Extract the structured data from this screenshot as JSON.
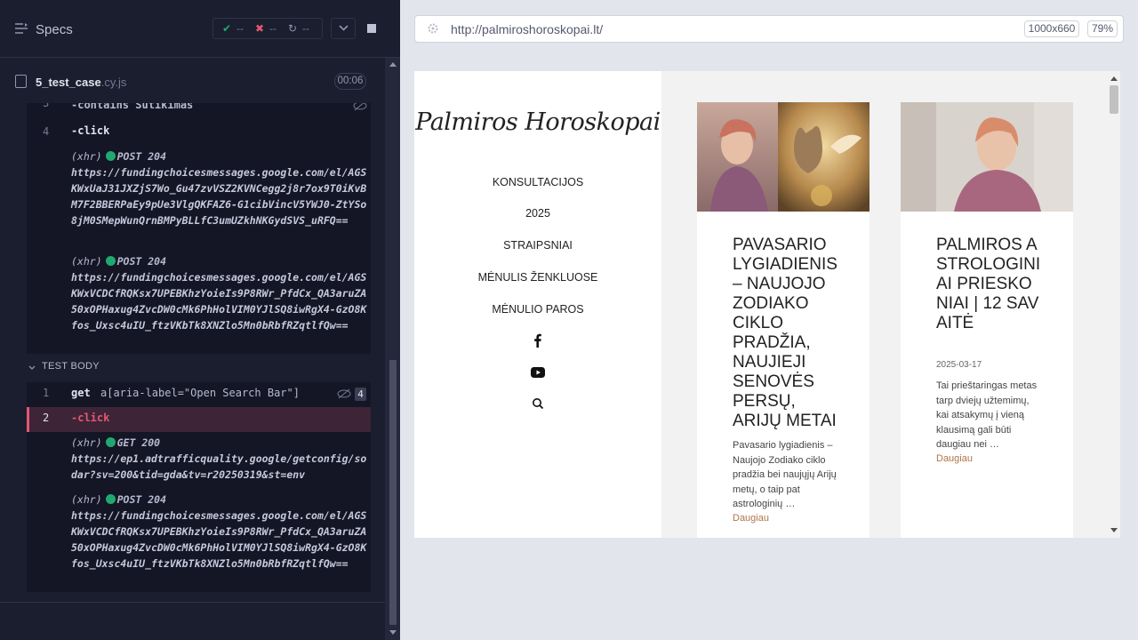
{
  "specs": {
    "title": "Specs",
    "passed": "--",
    "failed": "--",
    "pending": "--"
  },
  "file": {
    "name": "5_test_case",
    "ext": ".cy.js",
    "timer": "00:06"
  },
  "before_hook": {
    "line3_num": "3",
    "line3_text": "-contains  Sutikimas",
    "line4_num": "4",
    "line4_cmd": "-click",
    "xhr1_label": "(xhr)",
    "xhr1_status": "POST 204",
    "xhr1_url": "https://fundingchoicesmessages.google.com/el/AGSKWxUaJ31JXZjS7Wo_Gu47zvVSZ2KVNCegg2j8r7ox9T0iKvBM7F2BBERPaEy9pUe3VlgQKFAZ6-G1cibVincV5YWJ0-ZtYSo8jM0SMepWunQrnBMPyBLLfC3umUZkhNKGydSVS_uRFQ==",
    "xhr2_label": "(xhr)",
    "xhr2_status": "POST 204",
    "xhr2_url": "https://fundingchoicesmessages.google.com/el/AGSKWxVCDCfRQKsx7UPEBKhzYoieIs9P8RWr_PfdCx_QA3aruZA50xOPHaxug4ZvcDW0cMk6PhHolVIM0YJlSQ8iwRgX4-GzO8Kfos_Uxsc4uIU_ftzVKbTk8XNZlo5Mn0bRbfRZqtlfQw=="
  },
  "test_body": {
    "label": "TEST BODY",
    "l1_num": "1",
    "l1_cmd": "get",
    "l1_arg": "a[aria-label=\"Open Search Bar\"]",
    "l1_count": "4",
    "l2_num": "2",
    "l2_cmd": "-click",
    "xhr1_label": "(xhr)",
    "xhr1_status": "GET 200",
    "xhr1_url": "https://ep1.adtrafficquality.google/getconfig/sodar?sv=200&tid=gda&tv=r20250319&st=env",
    "xhr2_label": "(xhr)",
    "xhr2_status": "POST 204",
    "xhr2_url": "https://fundingchoicesmessages.google.com/el/AGSKWxVCDCfRQKsx7UPEBKhzYoieIs9P8RWr_PfdCx_QA3aruZA50xOPHaxug4ZvcDW0cMk6PhHolVIM0YJlSQ8iwRgX4-GzO8Kfos_Uxsc4uIU_ftzVKbTk8XNZlo5Mn0bRbfRZqtlfQw=="
  },
  "browser": {
    "url": "http://palmiroshoroskopai.lt/",
    "viewport": "1000x660",
    "zoom": "79%"
  },
  "site": {
    "logo": "Palmiros Horoskopai",
    "nav": [
      "KONSULTACIJOS",
      "2025",
      "STRAIPSNIAI",
      "MĖNULIS ŽENKLUOSE",
      "MĖNULIO PAROS"
    ],
    "cards": [
      {
        "title": "PAVASARIO LYGIADIENIS – NAUJOJO ZODIAKO CIKLO PRADŽIA, NAUJIEJI SENOVĖS PERSŲ, ARIJŲ METAI",
        "excerpt": "Pavasario lygiadienis – Naujojo Zodiako ciklo pradžia bei naujųjų Arijų metų, o taip pat astrologinių …",
        "more": "Daugiau"
      },
      {
        "title": "PALMIROS ASTROLOGINIAI PRIESKONIAI | 12 SAVAITĖ",
        "date": "2025-03-17",
        "excerpt": "Tai prieštaringas metas tarp dviejų užtemimų, kai atsakymų į vieną klausimą gali būti daugiau nei …",
        "more": "Daugiau"
      }
    ]
  },
  "colors": {
    "accent_fail": "#e45770",
    "accent_pass": "#1fa971",
    "link": "#b07548"
  }
}
